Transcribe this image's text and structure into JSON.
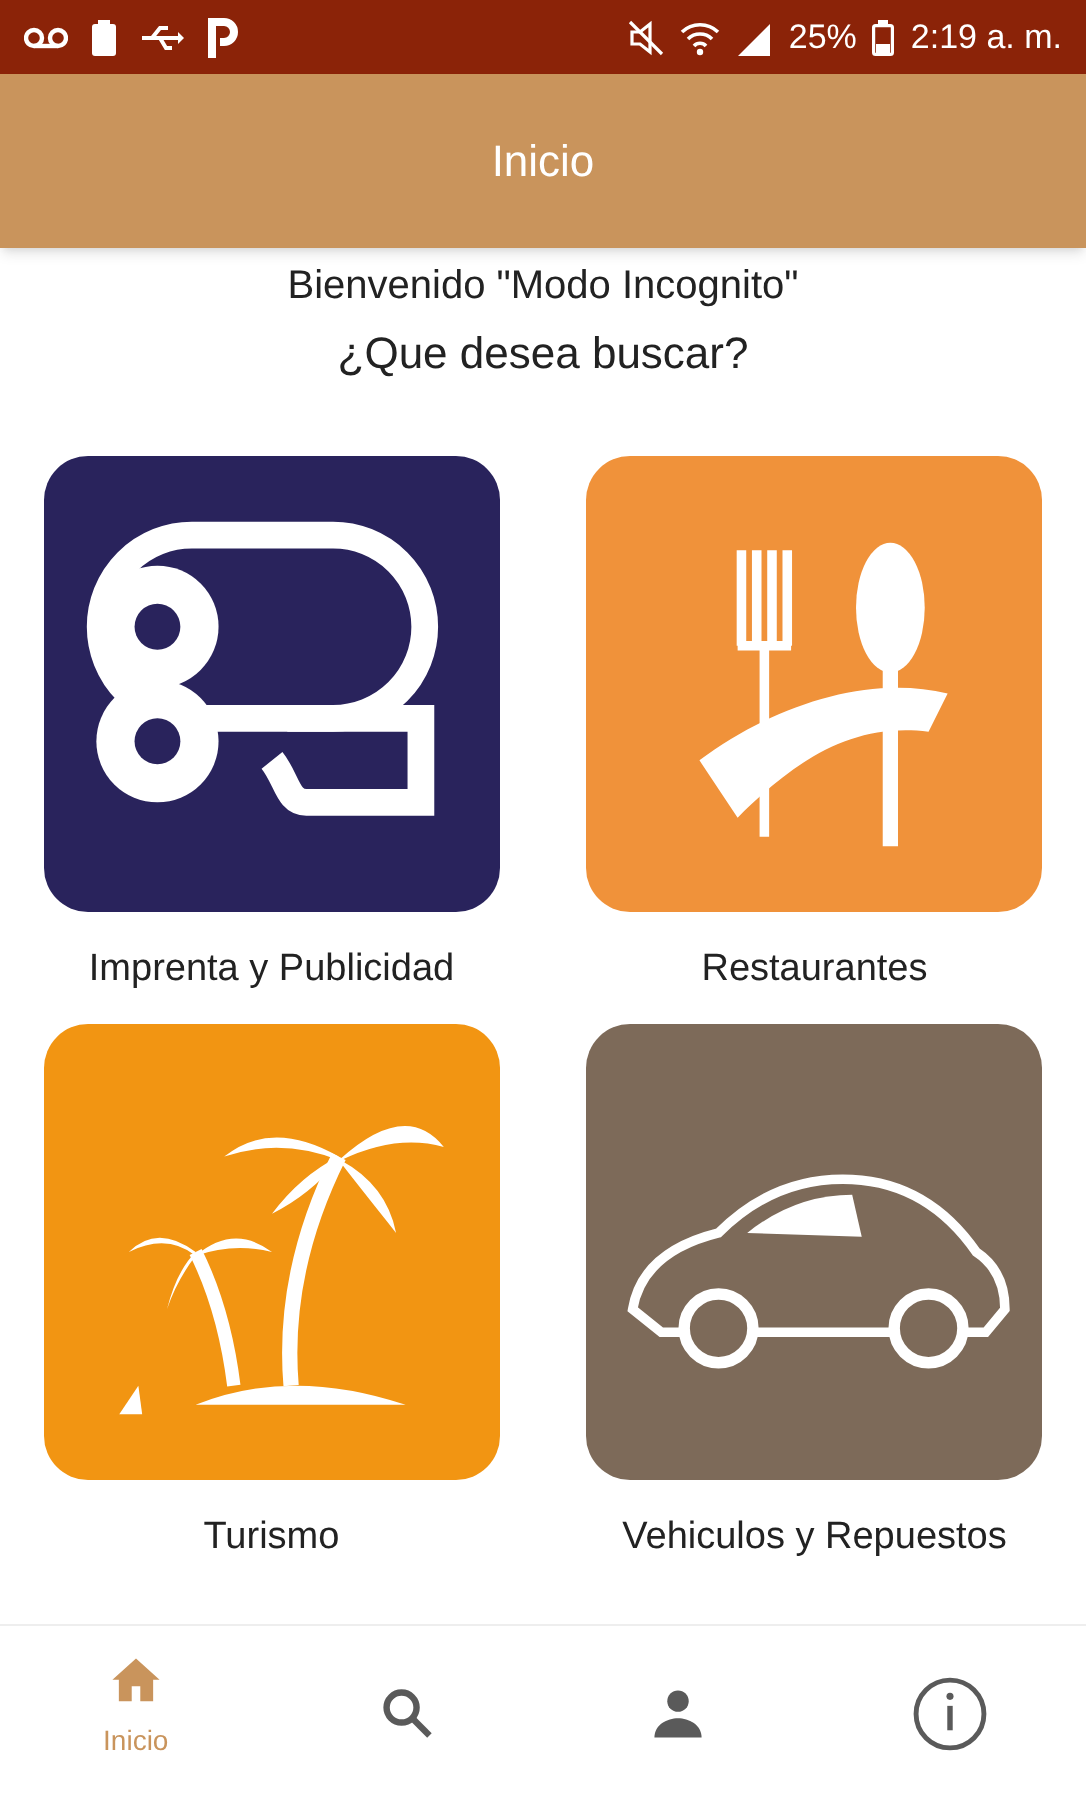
{
  "status_bar": {
    "battery": "25%",
    "time": "2:19 a. m."
  },
  "header": {
    "title": "Inicio"
  },
  "welcome": "Bienvenido \"Modo Incognito\"",
  "prompt": "¿Que desea buscar?",
  "categories": [
    {
      "kind": "print",
      "label": "Imprenta y Publicidad",
      "color": "#29235c"
    },
    {
      "kind": "food",
      "label": "Restaurantes",
      "color": "#f0923a"
    },
    {
      "kind": "beach",
      "label": "Turismo",
      "color": "#f29512"
    },
    {
      "kind": "car",
      "label": "Vehiculos y Repuestos",
      "color": "#7d6a59"
    }
  ],
  "nav": [
    {
      "kind": "home",
      "label": "Inicio",
      "selected": true
    },
    {
      "kind": "search",
      "selected": false
    },
    {
      "kind": "profile",
      "selected": false
    },
    {
      "kind": "info",
      "selected": false
    }
  ]
}
